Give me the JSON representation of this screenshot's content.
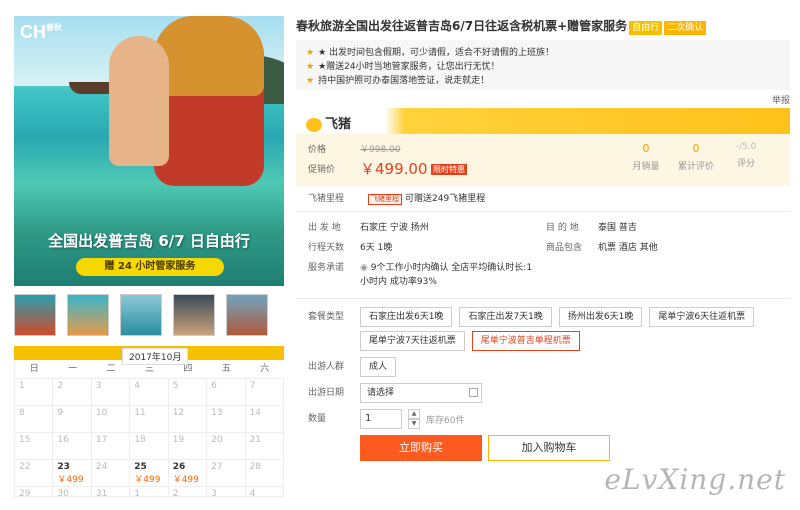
{
  "hero": {
    "logo": "CH",
    "logo_small": "春秋",
    "headline": "全国出发普吉岛 6/7 日自由行",
    "subline": "赠 24 小时管家服务"
  },
  "calendar": {
    "month": "2017年10月",
    "weekdays": [
      "日",
      "一",
      "二",
      "三",
      "四",
      "五",
      "六"
    ],
    "days": [
      "1",
      "2",
      "3",
      "4",
      "5",
      "6",
      "7",
      "8",
      "9",
      "10",
      "11",
      "12",
      "13",
      "14",
      "15",
      "16",
      "17",
      "18",
      "19",
      "20",
      "21",
      "22",
      "23",
      "24",
      "25",
      "26",
      "27",
      "28",
      "29",
      "30",
      "31",
      "1",
      "2",
      "3",
      "4"
    ],
    "prices": {
      "23": "￥499",
      "25": "￥499",
      "26": "￥499"
    }
  },
  "product": {
    "title": "春秋旅游全国出发往返普吉岛6/7日往返含税机票+赠管家服务",
    "tag1": "自由行",
    "tag2": "二次确认",
    "tips": [
      "出发时间包含假期，可少请假，适合不好请假的上班族！",
      "★赠送24小时当地管家服务，让您出行无忧！",
      "持中国护照可办泰国落地签证，说走就走！"
    ],
    "report": "举报",
    "brand": "飞猪",
    "price_label": "价格",
    "promo_label": "促销价",
    "old_price": "￥998.00",
    "new_price": "￥499.00",
    "limit_tag": "限时特惠",
    "stats": [
      {
        "value": "0",
        "label": "月销量"
      },
      {
        "value": "0",
        "label": "累计评价"
      },
      {
        "value": "-/5.0",
        "label": "评分"
      }
    ],
    "miles_label": "飞猪里程",
    "miles_tag": "飞猪里程",
    "miles_text": "可赠送249飞猪里程",
    "departure_label": "出 发 地",
    "departure": "石家庄   宁波   扬州",
    "destination_label": "目 的 地",
    "destination": "泰国   普吉",
    "days_label": "行程天数",
    "days_value": "6天   1晚",
    "includes_label": "商品包含",
    "includes": "机票   酒店   其他",
    "service_label": "服务承诺",
    "service_1": "9个工作小时内确认 全店平均确认时长:1",
    "service_2": "小时内 成功率93%",
    "package_label": "套餐类型",
    "packages": [
      "石家庄出发6天1晚",
      "石家庄出发7天1晚",
      "扬州出发6天1晚",
      "尾单宁波6天往返机票",
      "尾单宁波7天往返机票",
      "尾单宁波普吉单程机票"
    ],
    "crowd_label": "出游人群",
    "crowd": "成人",
    "date_label": "出游日期",
    "date_placeholder": "请选择",
    "qty_label": "数量",
    "qty": "1",
    "stock": "库存60件",
    "buy": "立即购买",
    "cart": "加入购物车"
  },
  "watermark": "eLvXing.net",
  "colors": {
    "accent": "#ffc21a",
    "price": "#e5411b",
    "buy": "#ff5a1f"
  }
}
